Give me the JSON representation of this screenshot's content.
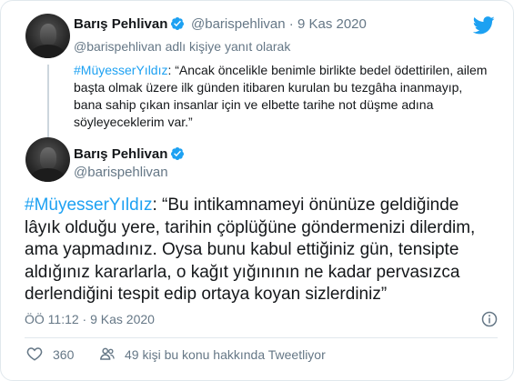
{
  "brand": {
    "color": "#1da1f2",
    "icon": "twitter-bird-icon"
  },
  "parent_tweet": {
    "display_name": "Barış Pehlivan",
    "handle": "@barispehlivan",
    "separator": "·",
    "date": "9 Kas 2020",
    "reply_context": "@barispehlivan adlı kişiye yanıt olarak",
    "hashtag": "#MüyesserYıldız",
    "text": ": “Ancak öncelikle benimle birlikte bedel ödettirilen, ailem başta olmak üzere ilk günden itibaren kurulan bu tezgâha inanmayıp, bana sahip çıkan insanlar için ve elbette tarihe not düşme adına söyleyeceklerim var.”"
  },
  "main_tweet": {
    "display_name": "Barış Pehlivan",
    "handle": "@barispehlivan",
    "hashtag": "#MüyesserYıldız",
    "text": ": “Bu intikamnameyi önünüze geldiğinde lâyık olduğu yere, tarihin çöplüğüne göndermenizi dilerdim, ama yapmadınız. Oysa bunu kabul ettiğiniz gün, tensipte aldığınız kararlarla, o kağıt yığınının ne kadar pervasızca derlendiğini tespit edip ortaya koyan sizlerdiniz”",
    "timestamp": "ÖÖ 11:12 · 9 Kas 2020",
    "likes": "360",
    "talking": "49 kişi bu konu hakkında Tweetliyor"
  }
}
